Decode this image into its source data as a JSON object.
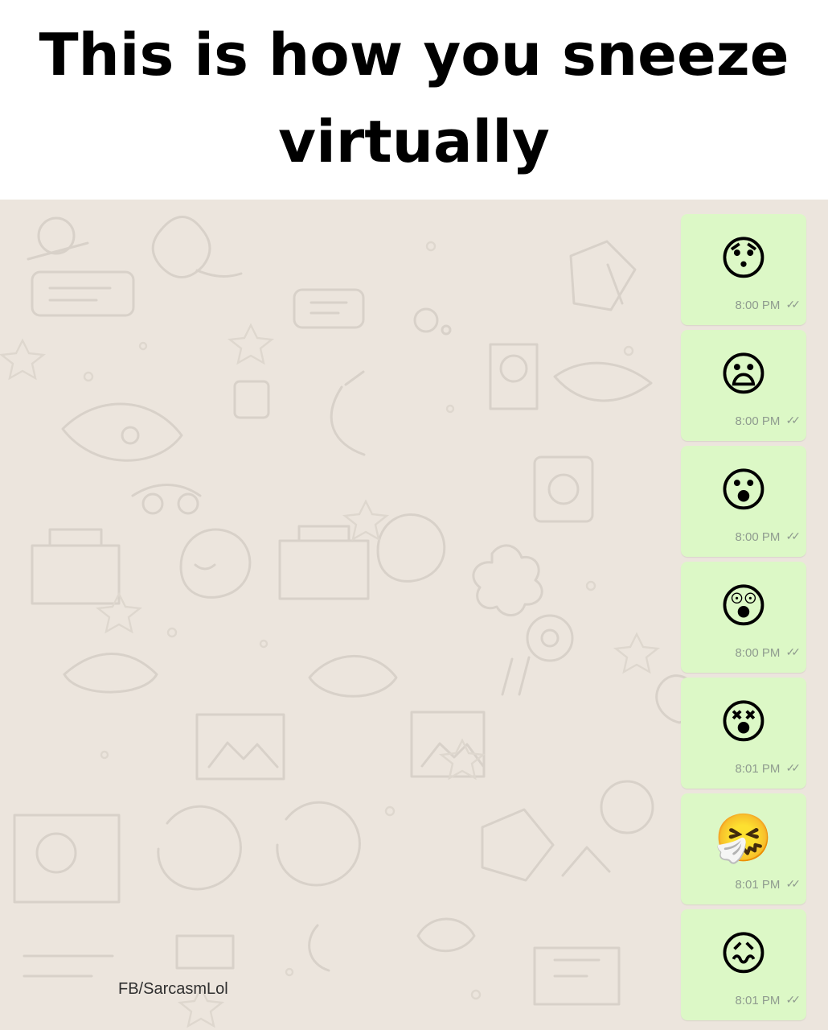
{
  "title": {
    "line1": "This is how you sneeze",
    "line2": "virtually"
  },
  "chat": {
    "background_color": "#ece5dd",
    "bubble_color": "#dcf8c6",
    "messages": [
      {
        "emoji": "😯",
        "icon": "hushed-face-icon",
        "time": "8:00 PM",
        "status_icon": "double-check-icon",
        "status": "✓✓"
      },
      {
        "emoji": "😦",
        "icon": "frowning-face-with-open-mouth-icon",
        "time": "8:00 PM",
        "status_icon": "double-check-icon",
        "status": "✓✓"
      },
      {
        "emoji": "😮",
        "icon": "face-with-open-mouth-icon",
        "time": "8:00 PM",
        "status_icon": "double-check-icon",
        "status": "✓✓"
      },
      {
        "emoji": "😲",
        "icon": "astonished-face-icon",
        "time": "8:00 PM",
        "status_icon": "double-check-icon",
        "status": "✓✓"
      },
      {
        "emoji": "😵",
        "icon": "dizzy-face-icon",
        "time": "8:01 PM",
        "status_icon": "double-check-icon",
        "status": "✓✓"
      },
      {
        "emoji": "🤧",
        "icon": "sneezing-face-icon",
        "time": "8:01 PM",
        "status_icon": "double-check-icon",
        "status": "✓✓"
      },
      {
        "emoji": "😖",
        "icon": "confounded-face-icon",
        "time": "8:01 PM",
        "status_icon": "double-check-icon",
        "status": "✓✓"
      }
    ]
  },
  "watermark": "FB/SarcasmLol"
}
